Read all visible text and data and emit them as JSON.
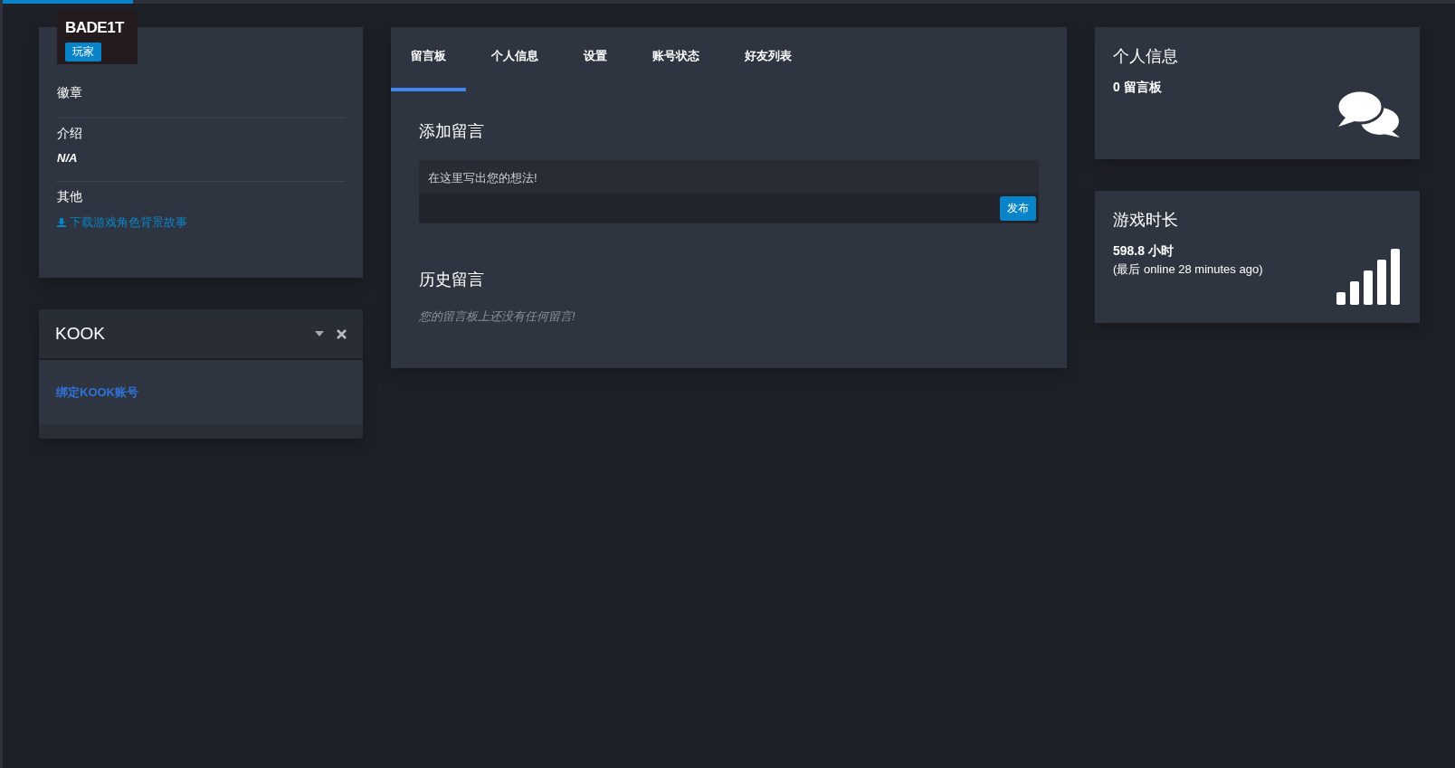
{
  "loading_bar": {
    "level": 0.09
  },
  "profile": {
    "name": "BADE1T",
    "role": "玩家",
    "sections": [
      {
        "kind": "plain",
        "title": "徽章"
      },
      {
        "kind": "italic",
        "title": "介绍",
        "value": "N/A"
      },
      {
        "kind": "download",
        "title": "其他",
        "link": "下载游戏角色背景故事"
      }
    ]
  },
  "kook": {
    "title": "KOOK",
    "link": "绑定KOOK账号"
  },
  "tabs": [
    {
      "label": "留言板",
      "selected": true
    },
    {
      "label": "个人信息",
      "selected": false
    },
    {
      "label": "设置",
      "selected": false
    },
    {
      "label": "账号状态",
      "selected": false
    },
    {
      "label": "好友列表",
      "selected": false
    }
  ],
  "add_comment": {
    "title": "添加留言",
    "placeholder": "在这里写出您的想法!",
    "button": "发布"
  },
  "history": {
    "title": "历史留言",
    "empty": "您的留言板上还没有任何留言!"
  },
  "stats": [
    {
      "kind": "comments",
      "title": "个人信息",
      "value": "0 留言板"
    },
    {
      "kind": "playtime",
      "title": "游戏时长",
      "value": "598.8 小时",
      "note": "(最后 online 28 minutes ago)"
    }
  ]
}
